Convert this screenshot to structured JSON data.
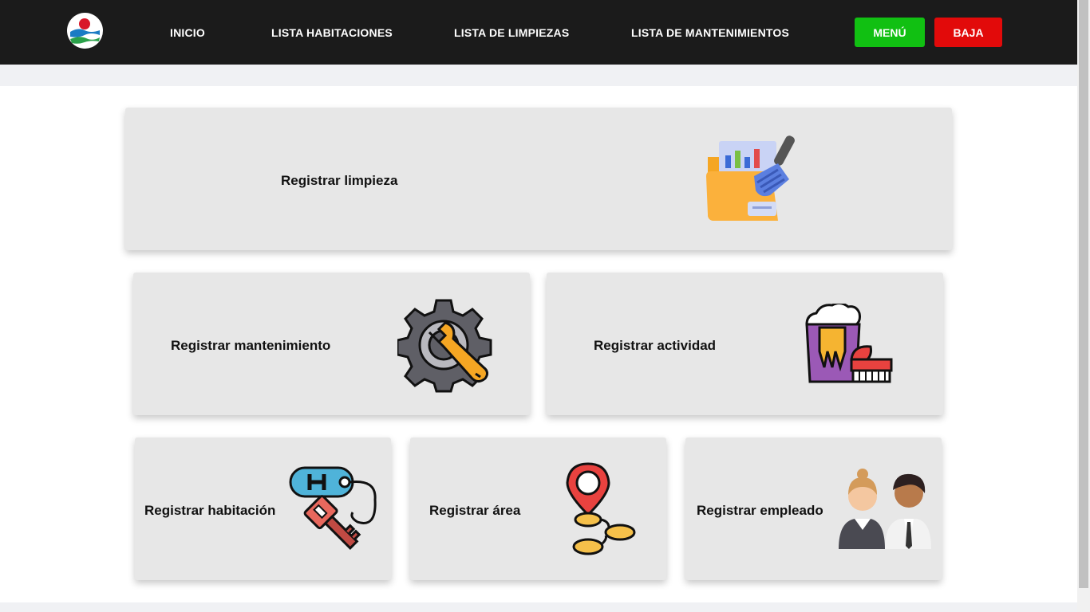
{
  "nav": {
    "links": [
      "INICIO",
      "LISTA HABITACIONES",
      "LISTA DE LIMPIEZAS",
      "LISTA DE MANTENIMIENTOS"
    ],
    "menu_button": "MENÚ",
    "baja_button": "BAJA"
  },
  "cards": {
    "limpieza": "Registrar limpieza",
    "mantenimiento": "Registrar mantenimiento",
    "actividad": "Registrar actividad",
    "habitacion": "Registrar habitación",
    "area": "Registrar área",
    "empleado": "Registrar empleado"
  },
  "colors": {
    "navbar": "#1b1b1b",
    "menu_button": "#11c012",
    "baja_button": "#e20a0a",
    "card": "#e7e7e7"
  },
  "icons": [
    "logo",
    "cleaning-folder-icon",
    "gear-wrench-icon",
    "cleaning-bucket-icon",
    "hotel-key-icon",
    "map-pin-icon",
    "employees-icon"
  ]
}
